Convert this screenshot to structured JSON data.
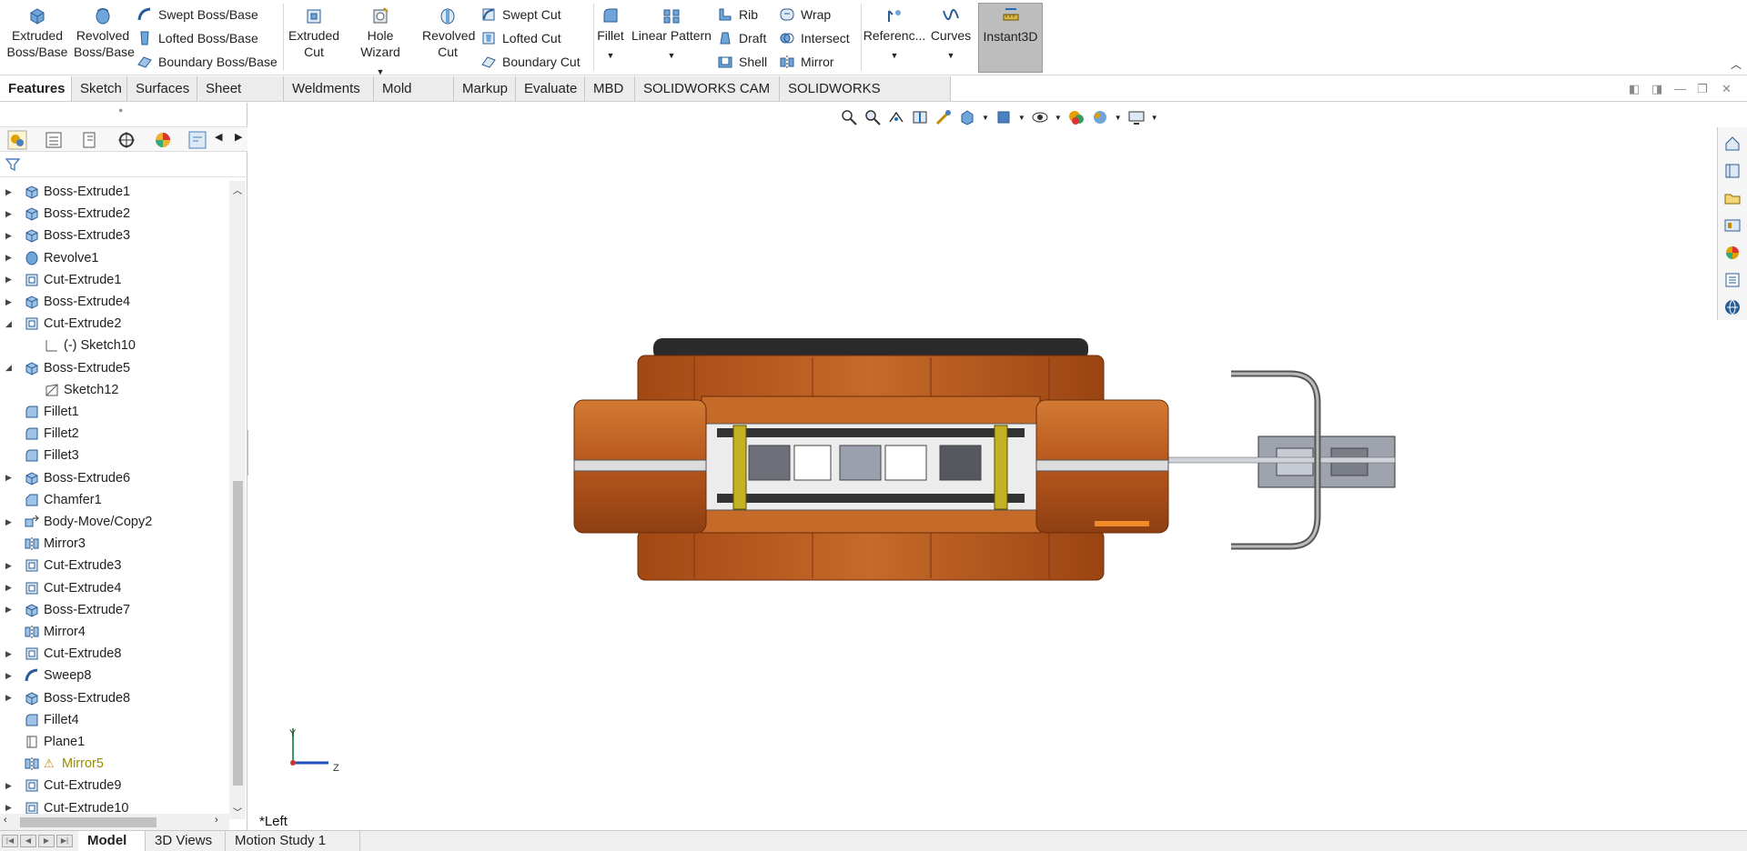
{
  "ribbon": {
    "extruded_boss": "Extruded Boss/Base",
    "revolved_boss": "Revolved Boss/Base",
    "swept_boss": "Swept Boss/Base",
    "lofted_boss": "Lofted Boss/Base",
    "boundary_boss": "Boundary Boss/Base",
    "extruded_cut": "Extruded Cut",
    "hole_wizard": "Hole Wizard",
    "revolved_cut": "Revolved Cut",
    "swept_cut": "Swept Cut",
    "lofted_cut": "Lofted Cut",
    "boundary_cut": "Boundary Cut",
    "fillet": "Fillet",
    "linear_pattern": "Linear Pattern",
    "rib": "Rib",
    "draft": "Draft",
    "shell": "Shell",
    "wrap": "Wrap",
    "intersect": "Intersect",
    "mirror": "Mirror",
    "reference": "Referenc...",
    "curves": "Curves",
    "instant3d": "Instant3D"
  },
  "tabs": [
    "Features",
    "Sketch",
    "Surfaces",
    "Sheet Metal",
    "Weldments",
    "Mold Tools",
    "Markup",
    "Evaluate",
    "MBD",
    "SOLIDWORKS CAM",
    "SOLIDWORKS Inspection"
  ],
  "tree": [
    {
      "label": "Boss-Extrude1",
      "icon": "extrude-icon",
      "expand": "collapsed",
      "indent": 0
    },
    {
      "label": "Boss-Extrude2",
      "icon": "extrude-icon",
      "expand": "collapsed",
      "indent": 0
    },
    {
      "label": "Boss-Extrude3",
      "icon": "extrude-icon",
      "expand": "collapsed",
      "indent": 0
    },
    {
      "label": "Revolve1",
      "icon": "revolve-icon",
      "expand": "collapsed",
      "indent": 0
    },
    {
      "label": "Cut-Extrude1",
      "icon": "cut-extrude-icon",
      "expand": "collapsed",
      "indent": 0
    },
    {
      "label": "Boss-Extrude4",
      "icon": "extrude-icon",
      "expand": "collapsed",
      "indent": 0
    },
    {
      "label": "Cut-Extrude2",
      "icon": "cut-extrude-icon",
      "expand": "expanded",
      "indent": 0
    },
    {
      "label": "(-) Sketch10",
      "icon": "sketch-icon",
      "expand": "none",
      "indent": 1
    },
    {
      "label": "Boss-Extrude5",
      "icon": "extrude-icon",
      "expand": "expanded",
      "indent": 0
    },
    {
      "label": "Sketch12",
      "icon": "sketch3d-icon",
      "expand": "none",
      "indent": 1
    },
    {
      "label": "Fillet1",
      "icon": "fillet-icon",
      "expand": "none",
      "indent": 0
    },
    {
      "label": "Fillet2",
      "icon": "fillet-icon",
      "expand": "none",
      "indent": 0
    },
    {
      "label": "Fillet3",
      "icon": "fillet-icon",
      "expand": "none",
      "indent": 0
    },
    {
      "label": "Boss-Extrude6",
      "icon": "extrude-icon",
      "expand": "collapsed",
      "indent": 0
    },
    {
      "label": "Chamfer1",
      "icon": "chamfer-icon",
      "expand": "none",
      "indent": 0
    },
    {
      "label": "Body-Move/Copy2",
      "icon": "move-copy-icon",
      "expand": "collapsed",
      "indent": 0
    },
    {
      "label": "Mirror3",
      "icon": "mirror-icon",
      "expand": "none",
      "indent": 0
    },
    {
      "label": "Cut-Extrude3",
      "icon": "cut-extrude-icon",
      "expand": "collapsed",
      "indent": 0
    },
    {
      "label": "Cut-Extrude4",
      "icon": "cut-extrude-icon",
      "expand": "collapsed",
      "indent": 0
    },
    {
      "label": "Boss-Extrude7",
      "icon": "extrude-icon",
      "expand": "collapsed",
      "indent": 0
    },
    {
      "label": "Mirror4",
      "icon": "mirror-icon",
      "expand": "none",
      "indent": 0
    },
    {
      "label": "Cut-Extrude8",
      "icon": "cut-extrude-icon",
      "expand": "collapsed",
      "indent": 0
    },
    {
      "label": "Sweep8",
      "icon": "sweep-icon",
      "expand": "collapsed",
      "indent": 0
    },
    {
      "label": "Boss-Extrude8",
      "icon": "extrude-icon",
      "expand": "collapsed",
      "indent": 0
    },
    {
      "label": "Fillet4",
      "icon": "fillet-icon",
      "expand": "none",
      "indent": 0
    },
    {
      "label": "Plane1",
      "icon": "plane-icon",
      "expand": "none",
      "indent": 0
    },
    {
      "label": "Mirror5",
      "icon": "mirror-icon",
      "expand": "none",
      "indent": 0,
      "warning": true
    },
    {
      "label": "Cut-Extrude9",
      "icon": "cut-extrude-icon",
      "expand": "collapsed",
      "indent": 0
    },
    {
      "label": "Cut-Extrude10",
      "icon": "cut-extrude-icon",
      "expand": "collapsed",
      "indent": 0
    }
  ],
  "viewport": {
    "view_name": "*Left",
    "triad_y": "Y",
    "triad_z": "Z"
  },
  "bottom_tabs": [
    "Model",
    "3D Views",
    "Motion Study 1"
  ],
  "colors": {
    "accent": "#1f6fbf",
    "copper": "#b5561c",
    "copper_dark": "#7a3410",
    "warning": "#9a8a00",
    "instant3d_bg": "#bdbdbd"
  }
}
